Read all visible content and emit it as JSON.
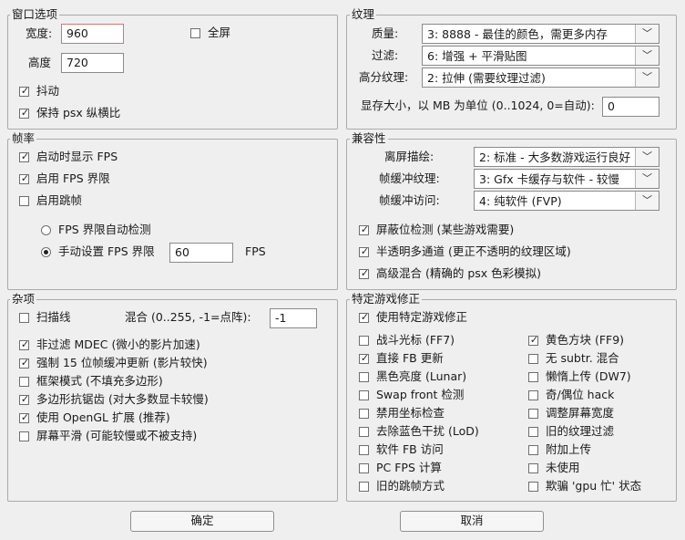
{
  "window_options": {
    "title": "窗口选项",
    "width_label": "宽度:",
    "width_value": "960",
    "height_label": "高度",
    "height_value": "720",
    "dither_label": "抖动",
    "fullscreen_label": "全屏",
    "keep_ratio_label": "保持 psx 纵横比"
  },
  "textures": {
    "title": "纹理",
    "quality_label": "质量:",
    "quality_value": "3: 8888 - 最佳的颜色，需更多内存",
    "filter_label": "过滤:",
    "filter_value": "6: 增强 + 平滑贴图",
    "hires_label": "高分纹理:",
    "hires_value": "2: 拉伸 (需要纹理过滤)",
    "vram_label": "显存大小，以 MB 为单位 (0..1024, 0=自动):",
    "vram_value": "0"
  },
  "framerate": {
    "title": "帧率",
    "show_fps_label": "启动时显示 FPS",
    "fps_limit_label": "启用 FPS 界限",
    "frame_skip_label": "启用跳帧",
    "auto_detect_label": "FPS 界限自动检测",
    "manual_label": "手动设置 FPS 界限",
    "manual_value": "60",
    "fps_unit": "FPS"
  },
  "compat": {
    "title": "兼容性",
    "offscreen_label": "离屏描绘:",
    "offscreen_value": "2: 标准 - 大多数游戏运行良好",
    "fb_tex_label": "帧缓冲纹理:",
    "fb_tex_value": "3: Gfx 卡缓存与软件 - 较慢",
    "fb_access_label": "帧缓冲访问:",
    "fb_access_value": "4: 纯软件 (FVP)",
    "mask_label": "屏蔽位检测 (某些游戏需要)",
    "multipass_label": "半透明多通道 (更正不透明的纹理区域)",
    "blend_label": "高级混合 (精确的 psx 色彩模拟)"
  },
  "misc": {
    "title": "杂项",
    "scanlines_label": "扫描线",
    "blend_label": "混合 (0..255, -1=点阵):",
    "blend_value": "-1",
    "mdec_label": "非过滤 MDEC (微小的影片加速)",
    "force15_label": "强制 15 位帧缓冲更新 (影片较快)",
    "wireframe_label": "框架模式 (不填充多边形)",
    "antialias_label": "多边形抗锯齿 (对大多数显卡较慢)",
    "opengl_ext_label": "使用 OpenGL 扩展 (推荐)",
    "smooth_label": "屏幕平滑 (可能较慢或不被支持)"
  },
  "fixes": {
    "title": "特定游戏修正",
    "enable_label": "使用特定游戏修正",
    "left": [
      {
        "label": "战斗光标 (FF7)",
        "checked": false
      },
      {
        "label": "直接 FB 更新",
        "checked": true
      },
      {
        "label": "黑色亮度 (Lunar)",
        "checked": false
      },
      {
        "label": "Swap front 检测",
        "checked": false
      },
      {
        "label": "禁用坐标检查",
        "checked": false
      },
      {
        "label": "去除蓝色干扰 (LoD)",
        "checked": false
      },
      {
        "label": "软件 FB 访问",
        "checked": false
      },
      {
        "label": "PC FPS 计算",
        "checked": false
      },
      {
        "label": "旧的跳帧方式",
        "checked": false
      }
    ],
    "right": [
      {
        "label": "黄色方块 (FF9)",
        "checked": true
      },
      {
        "label": "无 subtr. 混合",
        "checked": false
      },
      {
        "label": "懒惰上传 (DW7)",
        "checked": false
      },
      {
        "label": "奇/偶位 hack",
        "checked": false
      },
      {
        "label": "调整屏幕宽度",
        "checked": false
      },
      {
        "label": "旧的纹理过滤",
        "checked": false
      },
      {
        "label": "附加上传",
        "checked": false
      },
      {
        "label": "未使用",
        "checked": false
      },
      {
        "label": "欺骗 'gpu 忙' 状态",
        "checked": false
      }
    ]
  },
  "buttons": {
    "ok_label": "确定",
    "cancel_label": "取消"
  },
  "icons": {
    "checkmark": "✓",
    "dropdown": "﹀"
  }
}
